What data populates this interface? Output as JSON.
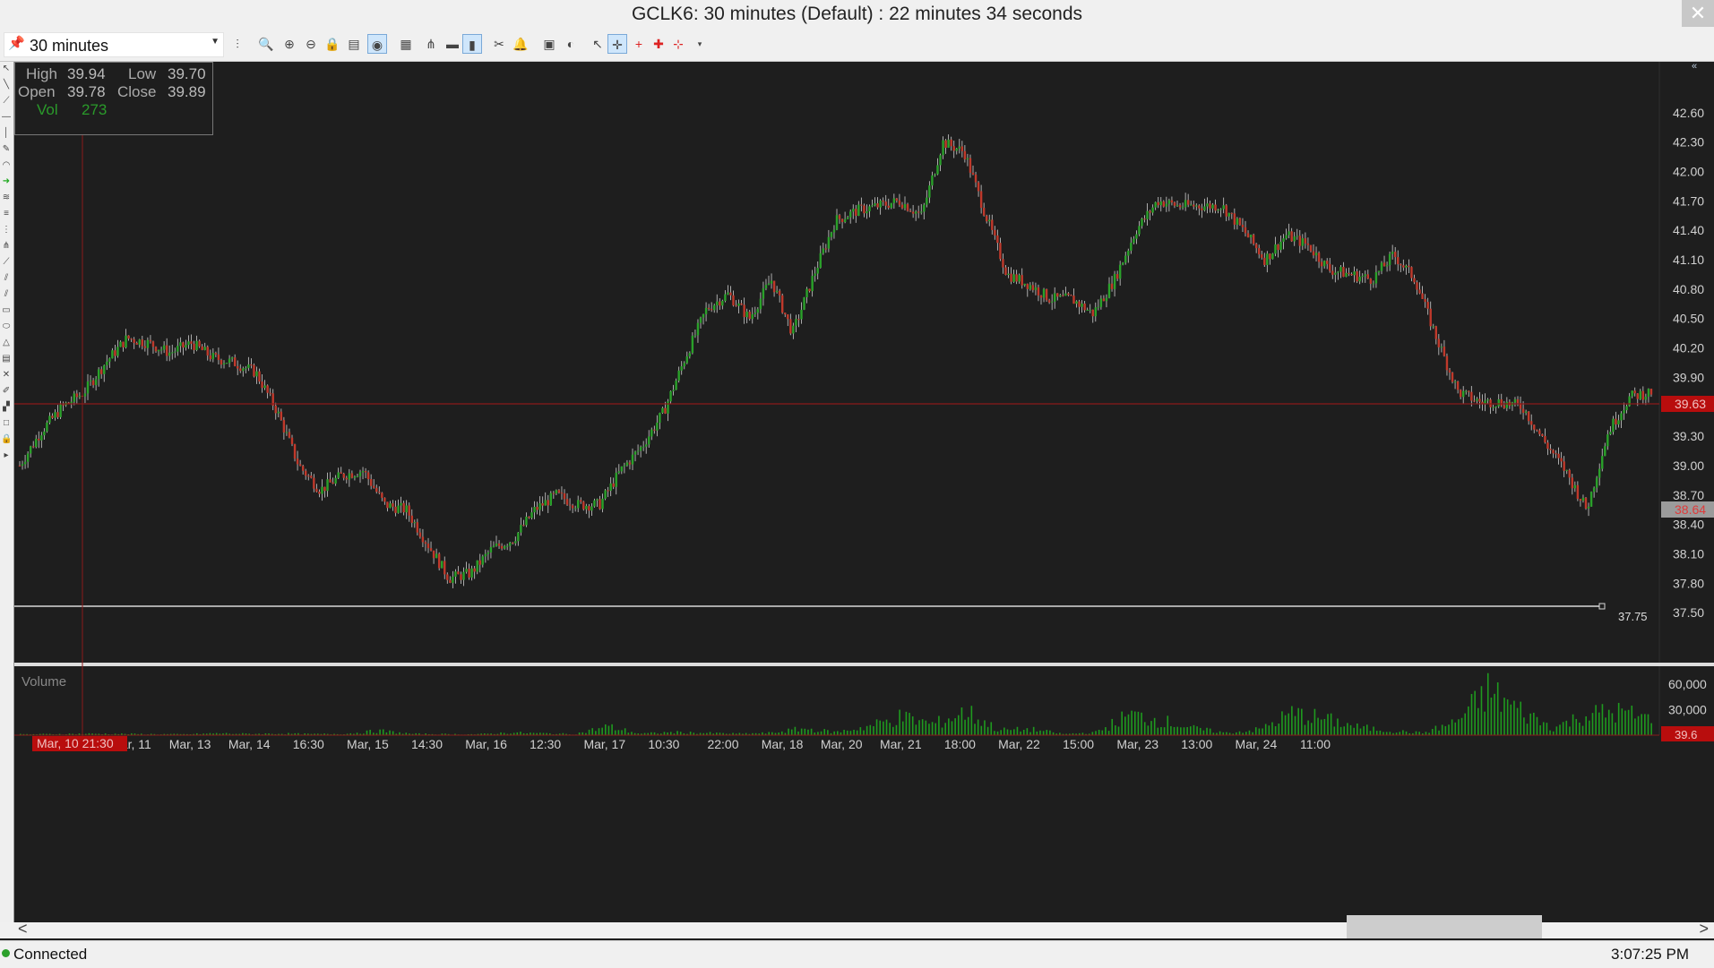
{
  "window": {
    "title": "GCLK6: 30 minutes (Default) : 22 minutes 34 seconds"
  },
  "toolbar": {
    "interval": "30 minutes"
  },
  "data_box": {
    "high_label": "High",
    "high": "39.94",
    "low_label": "Low",
    "low": "39.70",
    "open_label": "Open",
    "open": "39.78",
    "close_label": "Close",
    "close": "39.89",
    "vol_label": "Vol",
    "vol": "273"
  },
  "price_axis": {
    "ticks": [
      "42.60",
      "42.30",
      "42.00",
      "41.70",
      "41.40",
      "41.10",
      "40.80",
      "40.50",
      "40.20",
      "39.90",
      "39.30",
      "39.00",
      "38.70",
      "38.40",
      "38.10",
      "37.80",
      "37.50"
    ],
    "current_price_tag": "39.63",
    "crosshair_price_tag": "38.64",
    "horizontal_line_label": "37.75"
  },
  "volume_panel": {
    "title": "Volume",
    "ticks": [
      "60,000",
      "30,000"
    ],
    "crosshair_tag": "39.6"
  },
  "time_axis": {
    "crosshair_tag": "Mar, 10 21:30",
    "labels": [
      "Mar, 11",
      "Mar, 13",
      "Mar, 14",
      "16:30",
      "Mar, 15",
      "14:30",
      "Mar, 16",
      "12:30",
      "Mar, 17",
      "10:30",
      "22:00",
      "Mar, 18",
      "Mar, 20",
      "Mar, 21",
      "18:00",
      "Mar, 22",
      "15:00",
      "Mar, 23",
      "13:00",
      "Mar, 24",
      "11:00"
    ]
  },
  "status": {
    "connection": "Connected",
    "time": "3:07:25 PM"
  },
  "colors": {
    "up": "#2aa12a",
    "down": "#c0392b",
    "price_line": "#8b1a1a",
    "background": "#1e1e1e"
  },
  "chart_data": {
    "type": "line",
    "subtype": "candlestick",
    "symbol": "GCLK6",
    "interval": "30 minutes",
    "ylim": [
      37.3,
      42.9
    ],
    "x_labels": [
      "Mar, 11",
      "Mar, 13",
      "Mar, 14",
      "16:30",
      "Mar, 15",
      "14:30",
      "Mar, 16",
      "12:30",
      "Mar, 17",
      "10:30",
      "22:00",
      "Mar, 18",
      "Mar, 20",
      "Mar, 21",
      "18:00",
      "Mar, 22",
      "15:00",
      "Mar, 23",
      "13:00",
      "Mar, 24",
      "11:00"
    ],
    "series": [
      {
        "values": [
          39.0,
          39.35,
          39.6,
          39.75,
          40.05,
          40.3,
          40.25,
          40.15,
          40.25,
          40.1,
          40.05,
          39.95,
          39.55,
          39.0,
          38.75,
          38.9,
          38.95,
          38.6,
          38.55,
          38.2,
          37.85,
          37.9,
          38.15,
          38.25,
          38.55,
          38.7,
          38.6,
          38.6,
          38.95,
          39.2,
          39.55,
          40.1,
          40.6,
          40.75,
          40.5,
          40.9,
          40.35,
          40.95,
          41.5,
          41.6,
          41.65,
          41.7,
          41.55,
          42.3,
          42.2,
          41.55,
          40.95,
          40.85,
          40.7,
          40.7,
          40.55,
          40.9,
          41.4,
          41.7,
          41.65,
          41.65,
          41.65,
          41.4,
          41.1,
          41.35,
          41.25,
          41.0,
          40.95,
          40.9,
          41.15,
          40.9,
          40.3,
          39.75,
          39.65,
          39.65,
          39.6,
          39.25,
          38.95,
          38.55,
          39.35,
          39.7,
          39.75
        ]
      },
      {
        "name": "Volume",
        "values": [
          1200,
          1500,
          2000,
          1800,
          1500,
          1200,
          2500,
          1800,
          2200,
          1500,
          2000,
          6000,
          1800,
          1500,
          1200,
          3500,
          2500,
          1500,
          12000,
          2000,
          4000,
          3000,
          2000,
          3000,
          9000,
          4000,
          12000,
          25000,
          15000,
          32000,
          7000,
          8000,
          1500,
          4000,
          28000,
          20000,
          9000,
          3000,
          8000,
          30000,
          22000,
          11000,
          6000,
          3000,
          18000,
          60000,
          33000,
          10000,
          28000,
          32000,
          22000
        ]
      }
    ]
  }
}
